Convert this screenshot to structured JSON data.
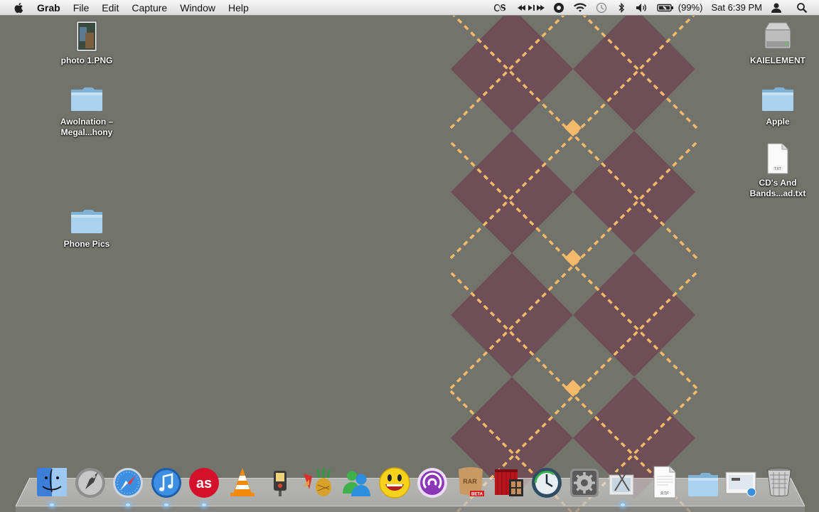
{
  "menubar": {
    "app_name": "Grab",
    "menus": [
      "File",
      "Edit",
      "Capture",
      "Window",
      "Help"
    ],
    "status": {
      "lastfm_icon": "lastfm-icon",
      "media_controls": "media-controls-icon",
      "wifi_icon": "wifi-icon",
      "bluetooth_icon": "bluetooth-icon",
      "volume_icon": "volume-icon",
      "battery_percent": "(99%)",
      "clock": "Sat 6:39 PM",
      "user_icon": "user-icon",
      "spotlight_icon": "search-icon"
    }
  },
  "desktop": {
    "left_icons": [
      {
        "label": "photo 1.PNG",
        "icon": "image-file-icon"
      },
      {
        "label": "Awolnation – Megal...hony",
        "icon": "folder-icon"
      },
      {
        "label": "Phone Pics",
        "icon": "folder-icon"
      }
    ],
    "right_icons": [
      {
        "label": "KAIELEMENT",
        "icon": "hard-drive-icon"
      },
      {
        "label": "Apple",
        "icon": "folder-icon"
      },
      {
        "label": "CD's And Bands...ad.txt",
        "icon": "txt-file-icon"
      }
    ]
  },
  "dock": {
    "items": [
      {
        "name": "finder-icon"
      },
      {
        "name": "launchpad-icon"
      },
      {
        "name": "safari-icon"
      },
      {
        "name": "itunes-icon"
      },
      {
        "name": "lastfm-icon"
      },
      {
        "name": "vlc-icon"
      },
      {
        "name": "usb-overdrive-icon"
      },
      {
        "name": "adium-icon"
      },
      {
        "name": "messenger-icon"
      },
      {
        "name": "yahoo-messenger-icon"
      },
      {
        "name": "bittorrent-icon"
      },
      {
        "name": "unrar-beta-icon"
      },
      {
        "name": "photo-booth-icon"
      },
      {
        "name": "time-machine-icon"
      },
      {
        "name": "system-preferences-icon"
      },
      {
        "name": "grab-icon"
      },
      {
        "name": "rtf-document-icon"
      },
      {
        "name": "documents-stack-icon"
      },
      {
        "name": "downloads-stack-icon"
      },
      {
        "name": "trash-icon"
      }
    ]
  },
  "colors": {
    "wallpaper": "#72736a",
    "argyle_diamond": "#6e4f57",
    "argyle_stitch": "#f5b96a"
  }
}
